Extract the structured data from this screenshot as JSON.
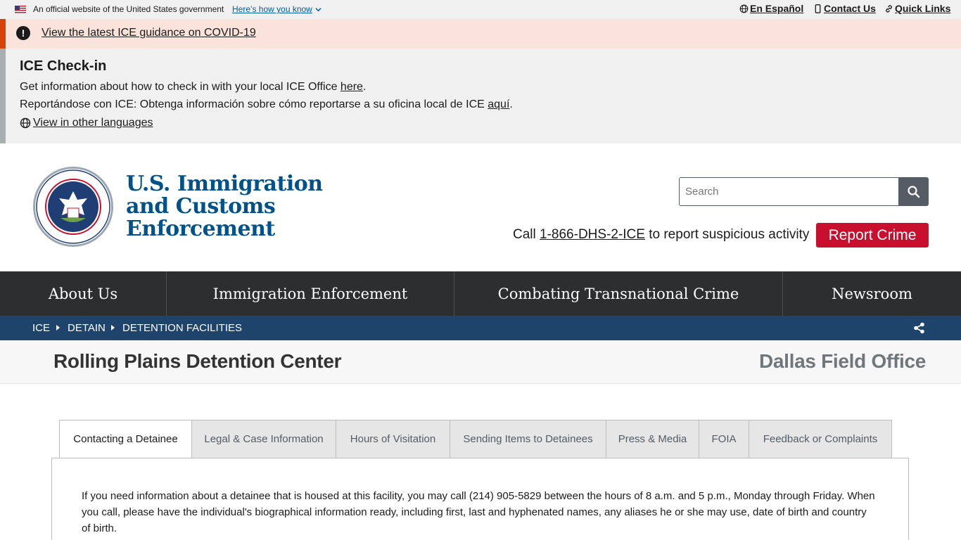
{
  "gov_banner": {
    "official_text": "An official website of the United States government",
    "how_know": "Here’s how you know",
    "links": [
      "En Español",
      "Contact Us",
      "Quick Links"
    ]
  },
  "alert": {
    "covid_link": "View the latest ICE guidance on COVID-19"
  },
  "checkin": {
    "title": "ICE Check-in",
    "line1_text": "Get information about how to check in with your local ICE Office ",
    "line1_link": "here",
    "line1_end": ".",
    "line2_text": "Reportándose con ICE: Obtenga información sobre cómo reportarse a su oficina local de ICE ",
    "line2_link": "aquí",
    "line2_end": ".",
    "languages_link": " View in other languages"
  },
  "header": {
    "agency_lines": [
      "U.S. Immigration",
      "and Customs",
      "Enforcement"
    ],
    "search_placeholder": "Search",
    "call_prefix": "Call ",
    "call_phone": "1-866-DHS-2-ICE",
    "call_suffix": " to report suspicious activity",
    "report_button": "Report Crime"
  },
  "main_nav": [
    {
      "label": "About Us"
    },
    {
      "label": "Immigration Enforcement"
    },
    {
      "label": "Combating Transnational Crime"
    },
    {
      "label": "Newsroom"
    }
  ],
  "breadcrumb": [
    "ICE",
    "DETAIN",
    "DETENTION FACILITIES"
  ],
  "page": {
    "title": "Rolling Plains Detention Center",
    "office": "Dallas Field Office"
  },
  "tabs": [
    {
      "label": "Contacting a Detainee",
      "active": true
    },
    {
      "label": "Legal & Case Information"
    },
    {
      "label": "Hours of Visitation"
    },
    {
      "label": "Sending Items to Detainees"
    },
    {
      "label": "Press & Media"
    },
    {
      "label": "FOIA"
    },
    {
      "label": "Feedback or Complaints"
    }
  ],
  "content": {
    "paragraph": "If you need information about a detainee that is housed at this facility, you may call (214) 905-5829 between the hours of 8 a.m. and 5 p.m., Monday through Friday. When you call, please have the individual's biographical information ready, including first, last and hyphenated names, any aliases he or she may use, date of birth and country of birth."
  },
  "colors": {
    "alert_accent": "#d54309",
    "report_red": "#c8102e",
    "nav_dark": "#2d2e2f",
    "breadcrumb_blue": "#1f446b",
    "agency_blue": "#005288"
  }
}
